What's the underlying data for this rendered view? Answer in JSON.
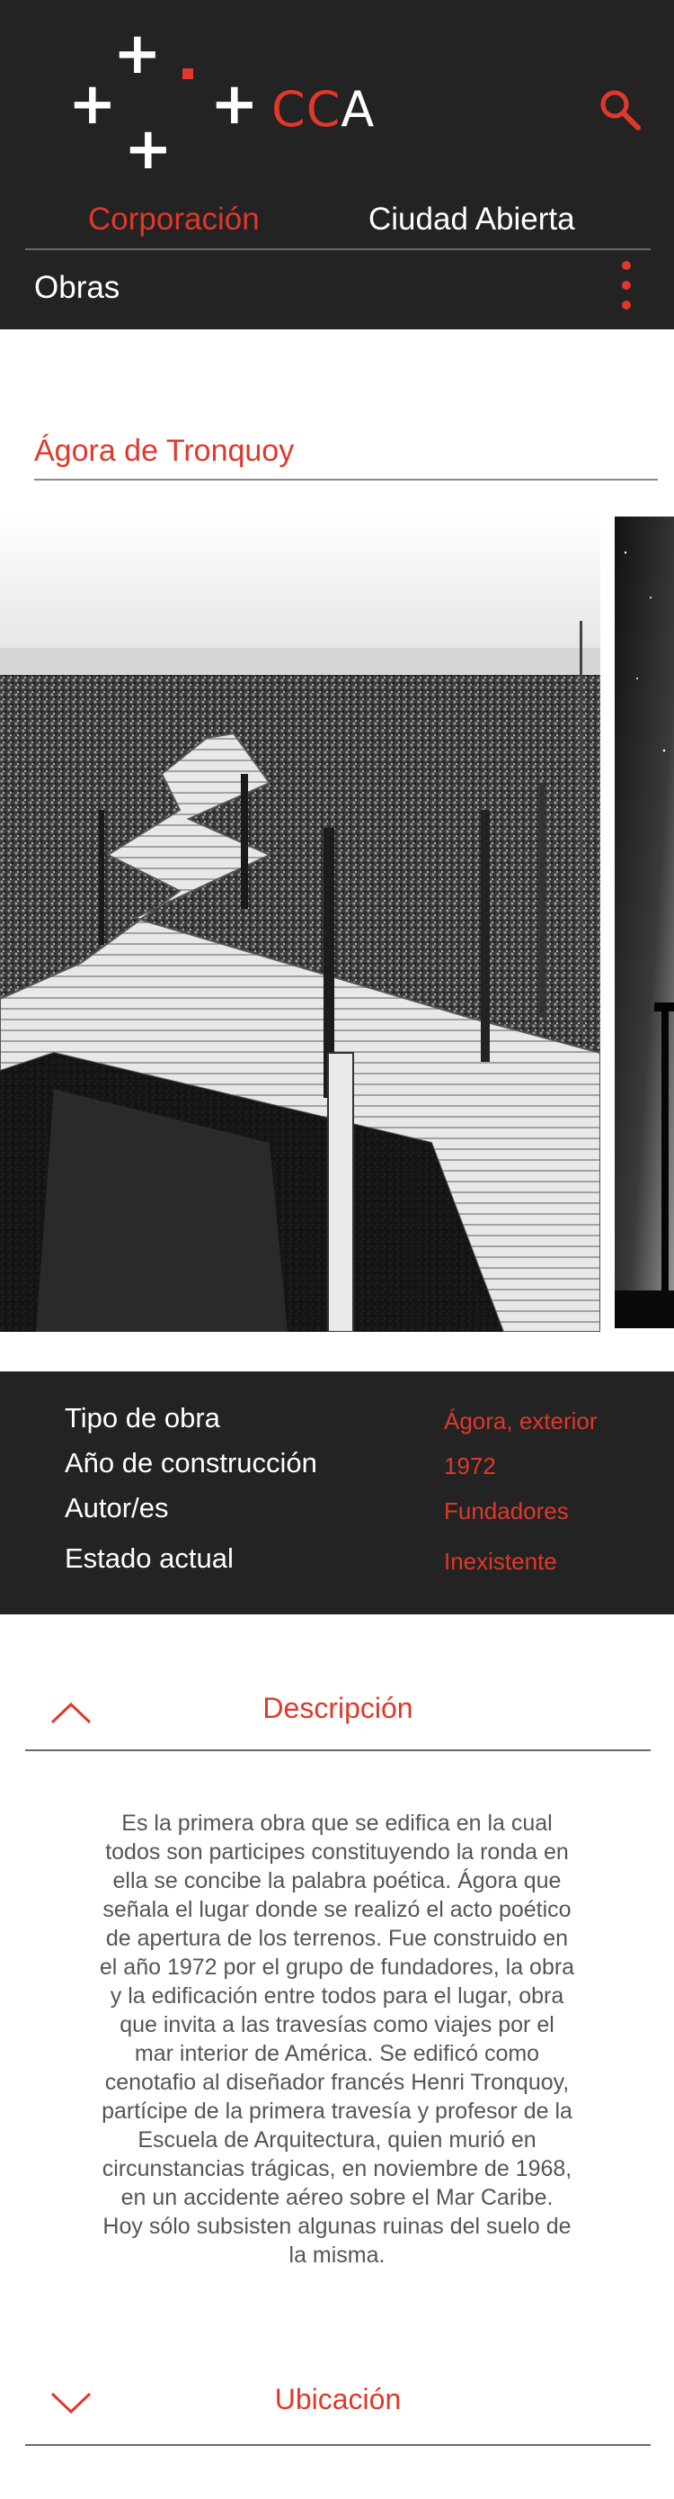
{
  "header": {
    "logo": {
      "word_red": "CC",
      "word_white": "A"
    },
    "nav": {
      "corporacion": "Corporación",
      "ciudad_abierta": "Ciudad Abierta"
    },
    "section": "Obras",
    "icons": {
      "search": "search-icon",
      "menu": "kebab-menu-icon"
    }
  },
  "page": {
    "title": "Ágora de Tronquoy"
  },
  "info": {
    "rows": [
      {
        "key": "Tipo de obra",
        "value": "Ágora, exterior"
      },
      {
        "key": "Año de construcción",
        "value": "1972"
      },
      {
        "key": "Autor/es",
        "value": "Fundadores"
      },
      {
        "key": "Estado actual",
        "value": "Inexistente"
      }
    ]
  },
  "description": {
    "title": "Descripción",
    "text": "Es la primera obra que se edifica en la cual todos son participes constituyendo la ronda en ella se concibe la palabra poética. Ágora que señala el lugar donde se realizó el acto poético de apertura de los terrenos. Fue construido en el año 1972 por el grupo de fundadores, la obra y la edificación entre todos para el lugar, obra que invita a las travesías como viajes por el mar interior de América. Se edificó como cenotafio al diseñador francés Henri Tronquoy, partícipe de la primera travesía y profesor de la Escuela de Arquitectura, quien murió en circunstancias trágicas, en noviembre de 1968, en un accidente aéreo sobre el Mar Caribe. Hoy sólo subsisten algunas ruinas del suelo de la misma."
  },
  "location": {
    "title": "Ubicación"
  },
  "colors": {
    "accent": "#e0382a",
    "dark": "#232323"
  }
}
